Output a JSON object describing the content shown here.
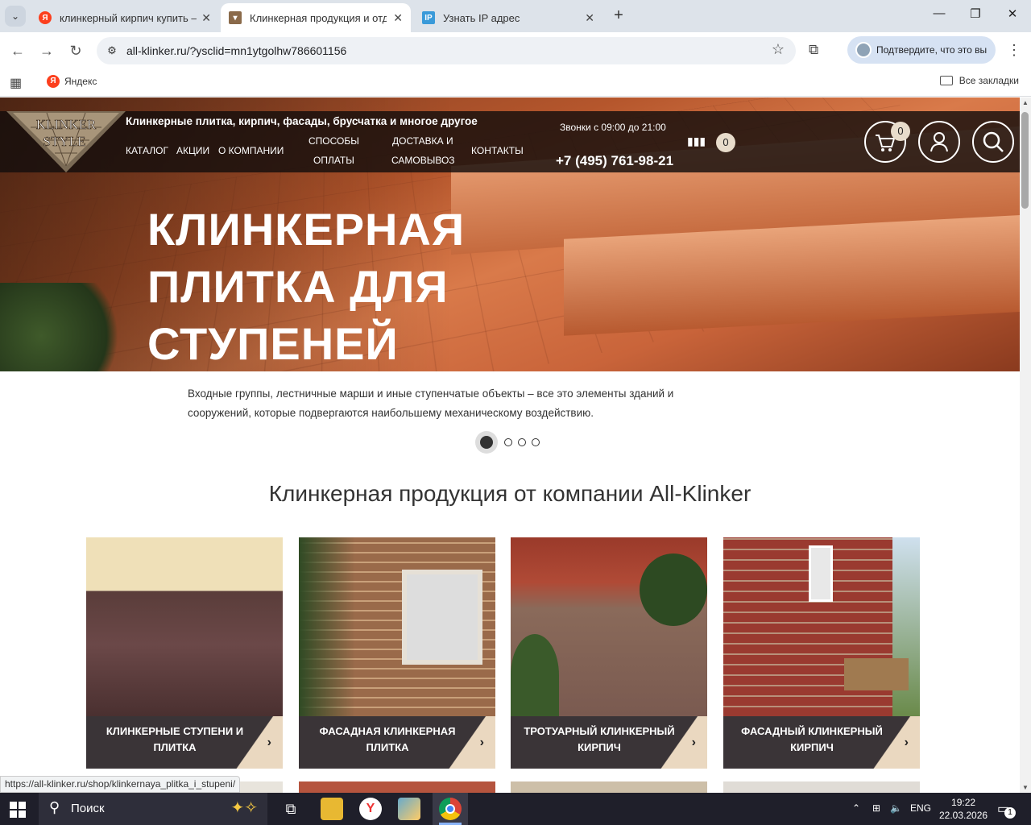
{
  "browser": {
    "tabs": [
      {
        "title": "клинкерный кирпич купить —",
        "favicon": "yandex-icon",
        "active": false
      },
      {
        "title": "Клинкерная продукция и отде",
        "favicon": "klinker-icon",
        "active": true
      },
      {
        "title": "Узнать IP адрес",
        "favicon": "ip-icon",
        "active": false
      }
    ],
    "url": "all-klinker.ru/?ysclid=mn1ytgolhw786601156",
    "profile_label": "Подтвердите, что это вы",
    "bookmarks": {
      "yandex": "Яндекс",
      "all": "Все закладки"
    },
    "status_url": "https://all-klinker.ru/shop/klinkernaya_plitka_i_stupeni/"
  },
  "site": {
    "logo_line1": "KLINKER",
    "logo_line2": "STYLE",
    "tagline": "Клинкерные плитка, кирпич, фасады, брусчатка и многое другое",
    "nav": {
      "catalog": "КАТАЛОГ",
      "promos": "АКЦИИ",
      "about": "О КОМПАНИИ",
      "payment_l1": "СПОСОБЫ",
      "payment_l2": "ОПЛАТЫ",
      "delivery_l1": "ДОСТАВКА И",
      "delivery_l2": "САМОВЫВОЗ",
      "contacts": "КОНТАКТЫ"
    },
    "hours": "Звонки с 09:00 до 21:00",
    "phone": "+7 (495) 761-98-21",
    "compare_count": "0",
    "cart_count": "0",
    "hero": {
      "line1": "КЛИНКЕРНАЯ",
      "line2": "ПЛИТКА ДЛЯ",
      "line3": "СТУПЕНЕЙ",
      "desc": "Входные группы, лестничные марши и иные ступенчатые объекты – все это элементы зданий и сооружений, которые подвергаются наибольшему механическому воздействию.",
      "slide_index": 1,
      "slide_total": 4
    },
    "section_title": "Клинкерная продукция от компании All-Klinker",
    "cards": [
      {
        "label": "КЛИНКЕРНЫЕ СТУПЕНИ И ПЛИТКА"
      },
      {
        "label": "ФАСАДНАЯ КЛИНКЕРНАЯ ПЛИТКА"
      },
      {
        "label": "ТРОТУАРНЫЙ КЛИНКЕРНЫЙ КИРПИЧ"
      },
      {
        "label": "ФАСАДНЫЙ КЛИНКЕРНЫЙ КИРПИЧ"
      }
    ]
  },
  "taskbar": {
    "search": "Поиск",
    "lang": "ENG",
    "time": "19:22",
    "date": "22.03.2026",
    "notifications": "1"
  },
  "colors": {
    "accent": "#ead8c0",
    "header_bg": "#140e0c",
    "card_label_bg": "#3a3437"
  }
}
